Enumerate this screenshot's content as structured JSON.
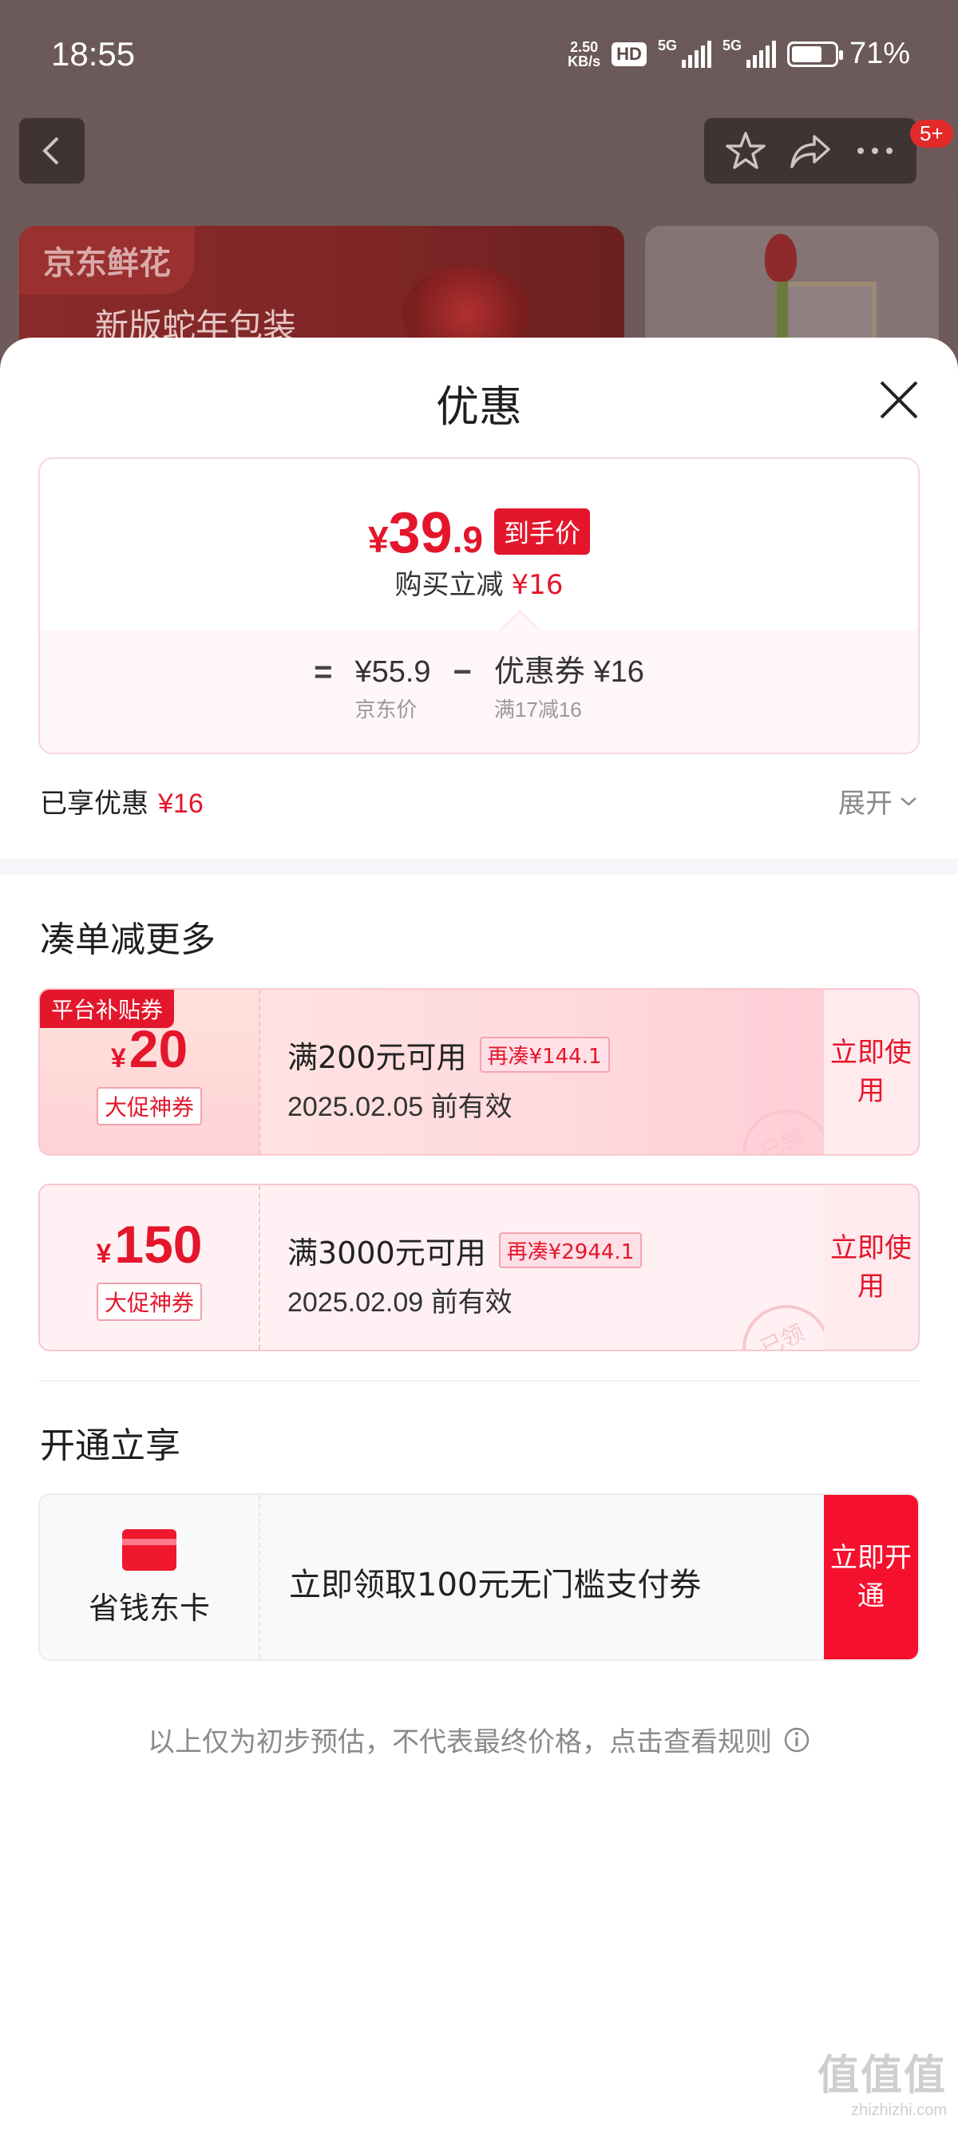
{
  "status_bar": {
    "time": "18:55",
    "net_speed_value": "2.50",
    "net_speed_unit": "KB/s",
    "hd_badge": "HD",
    "sim1_label": "5G",
    "sim2_label": "5G",
    "battery_level": 0.71,
    "battery_percent": "71%"
  },
  "background_page": {
    "notification_count": "5+",
    "banner_tag": "京东鲜花",
    "banner_subtitle": "新版蛇年包装"
  },
  "sheet": {
    "title": "优惠",
    "price": {
      "currency": "¥",
      "integer": "39",
      "decimal": ".9",
      "final_tag": "到手价",
      "discount_label": "购买立减",
      "discount_value": "¥16",
      "formula": {
        "equals": "=",
        "minus": "−",
        "base_value": "¥55.9",
        "base_label": "京东价",
        "coupon_value": "优惠券 ¥16",
        "coupon_label": "满17减16"
      }
    },
    "enjoyed_label": "已享优惠",
    "enjoyed_value": "¥16",
    "expand_label": "展开",
    "more_section_title": "凑单减更多",
    "coupons": [
      {
        "ribbon": "平台补贴券",
        "currency": "¥",
        "amount": "20",
        "kind": "大促神券",
        "condition": "满200元可用",
        "more": "再凑¥144.1",
        "expiry": "2025.02.05 前有效",
        "action": "立即使用",
        "stamp": "已领"
      },
      {
        "ribbon": "",
        "currency": "¥",
        "amount": "150",
        "kind": "大促神券",
        "condition": "满3000元可用",
        "more": "再凑¥2944.1",
        "expiry": "2025.02.09 前有效",
        "action": "立即使用",
        "stamp": "已领"
      }
    ],
    "open_section_title": "开通立享",
    "vip": {
      "name": "省钱东卡",
      "description": "立即领取100元无门槛支付券",
      "action": "立即开通"
    },
    "footnote": "以上仅为初步预估，不代表最终价格，点击查看规则"
  },
  "watermark": {
    "text": "值值值",
    "url": "zhizhizhi.com"
  },
  "colors": {
    "accent_red": "#e4162b",
    "sheet_bg": "#ffffff",
    "overlay": "#5d4a4a"
  }
}
